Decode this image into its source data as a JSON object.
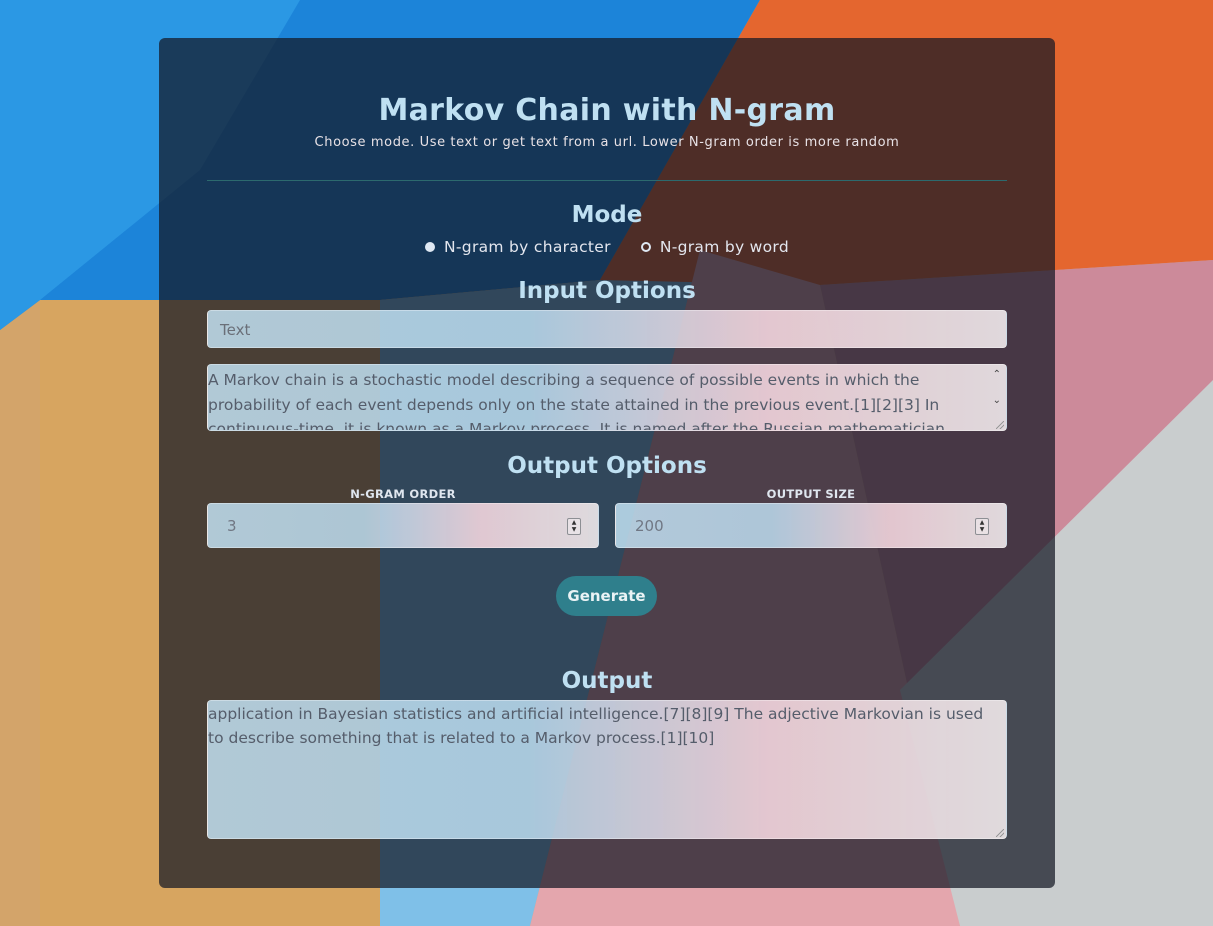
{
  "header": {
    "title": "Markov Chain with N-gram",
    "subtitle": "Choose mode. Use text or get text from a url. Lower N-gram order is more random"
  },
  "mode": {
    "title": "Mode",
    "options": [
      {
        "label": "N-gram by character",
        "selected": true
      },
      {
        "label": "N-gram by word",
        "selected": false
      }
    ]
  },
  "input_options": {
    "title": "Input Options",
    "source_select_value": "Text",
    "text": "A Markov chain is a stochastic model describing a sequence of possible events in which the probability of each event depends only on the state attained in the previous event.[1][2][3] In continuous-time, it is known as a Markov process. It is named after the Russian mathematician Andrey Markov."
  },
  "output_options": {
    "title": "Output Options",
    "ngram_order_label": "N-GRAM ORDER",
    "ngram_order_value": "3",
    "output_size_label": "OUTPUT SIZE",
    "output_size_value": "200"
  },
  "generate_label": "Generate",
  "output": {
    "title": "Output",
    "text": "application in Bayesian statistics and artificial intelligence.[7][8][9] The adjective Markovian is used to describe something that is related to a Markov process.[1][10]"
  },
  "colors": {
    "title": "#bfe0f2",
    "button": "#2f7f8c",
    "panel": "rgba(20,24,36,0.72)"
  }
}
